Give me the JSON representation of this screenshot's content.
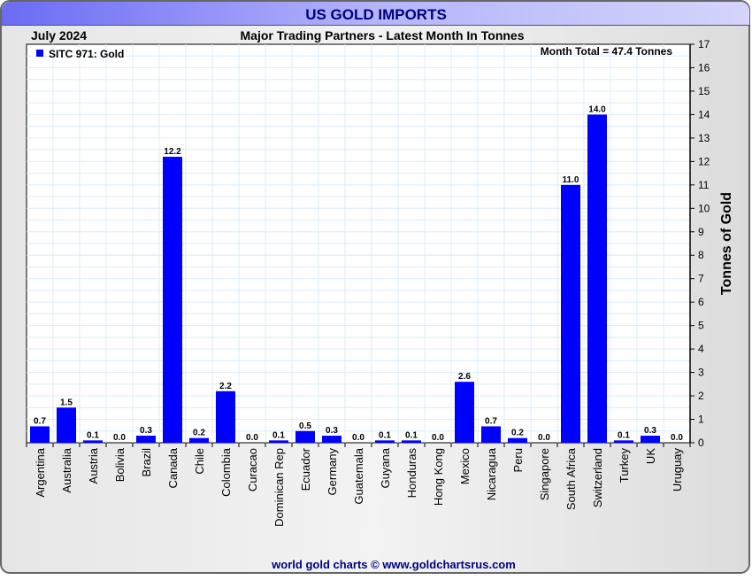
{
  "chart_data": {
    "type": "bar",
    "title": "US GOLD IMPORTS",
    "subtitle": "Major Trading Partners - Latest Month In Tonnes",
    "period": "July 2024",
    "legend": {
      "label": "SITC 971: Gold",
      "placement": "top-left"
    },
    "annotation": "Month Total = 47.4 Tonnes",
    "ylabel": "Tonnes of Gold",
    "xlabel": "",
    "ylim": [
      0,
      17
    ],
    "yticks": [
      0,
      1,
      2,
      3,
      4,
      5,
      6,
      7,
      8,
      9,
      10,
      11,
      12,
      13,
      14,
      15,
      16,
      17
    ],
    "grid": true,
    "categories": [
      "Argentina",
      "Australia",
      "Austria",
      "Bolivia",
      "Brazil",
      "Canada",
      "Chile",
      "Colombia",
      "Curacao",
      "Dominican Rep",
      "Ecuador",
      "Germany",
      "Guatemala",
      "Guyana",
      "Honduras",
      "Hong Kong",
      "Mexico",
      "Nicaragua",
      "Peru",
      "Singapore",
      "South Africa",
      "Switzerland",
      "Turkey",
      "UK",
      "Uruguay"
    ],
    "values": [
      0.7,
      1.5,
      0.1,
      0.0,
      0.3,
      12.2,
      0.2,
      2.2,
      0.0,
      0.1,
      0.5,
      0.3,
      0.0,
      0.1,
      0.1,
      0.0,
      2.6,
      0.7,
      0.2,
      0.0,
      11.0,
      14.0,
      0.1,
      0.3,
      0.0
    ],
    "bar_color": "#0000ff",
    "footer": "world gold charts © www.goldchartsrus.com"
  }
}
